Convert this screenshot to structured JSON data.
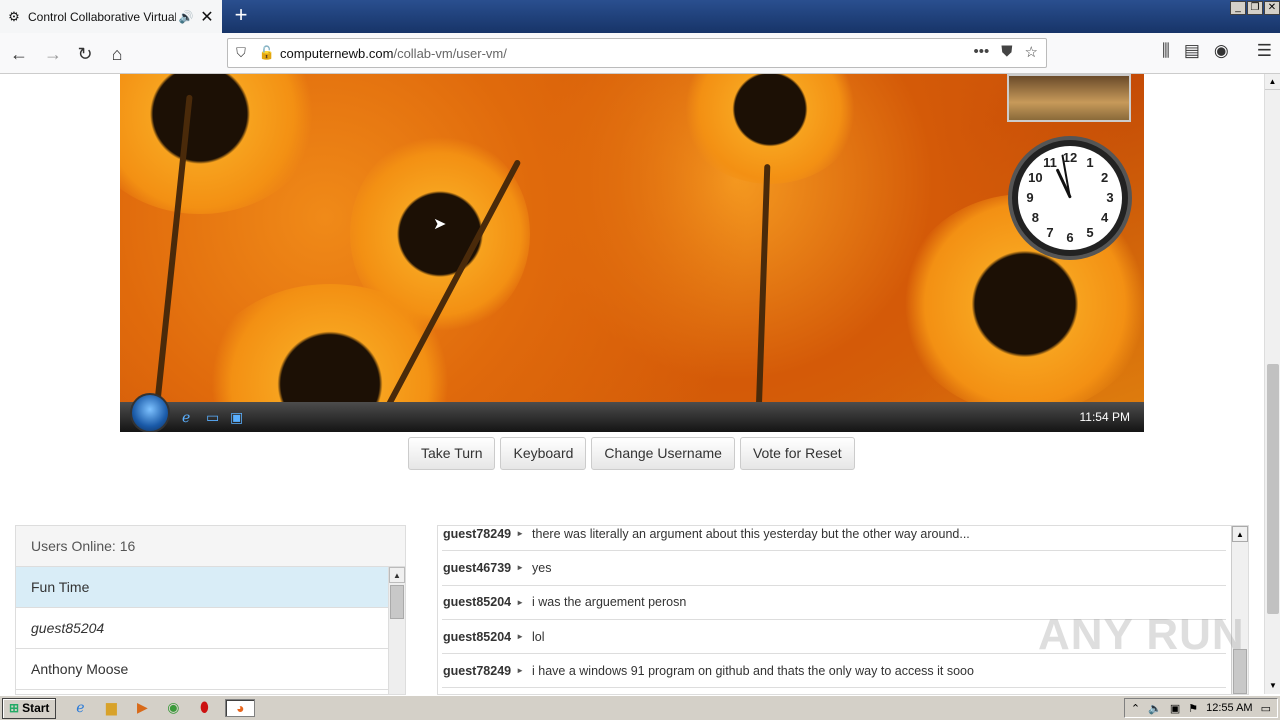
{
  "browser": {
    "tab_title": "Control Collaborative Virtual M",
    "url_host": "computernewb.com",
    "url_path": "/collab-vm/user-vm/"
  },
  "vm": {
    "clock_time": "11:54 PM",
    "clock_numbers": [
      "12",
      "1",
      "2",
      "3",
      "4",
      "5",
      "6",
      "7",
      "8",
      "9",
      "10",
      "11"
    ]
  },
  "controls": {
    "take_turn": "Take Turn",
    "keyboard": "Keyboard",
    "change_username": "Change Username",
    "vote_reset": "Vote for Reset"
  },
  "users": {
    "header": "Users Online: 16",
    "list": [
      "Fun Time",
      "guest85204",
      "Anthony Moose"
    ]
  },
  "chat": {
    "messages": [
      {
        "user": "guest78249",
        "text": "there was literally an argument about this yesterday but the other way around..."
      },
      {
        "user": "guest46739",
        "text": "yes"
      },
      {
        "user": "guest85204",
        "text": "i was the arguement perosn"
      },
      {
        "user": "guest85204",
        "text": "lol"
      },
      {
        "user": "guest78249",
        "text": "i have a windows 91 program on github and thats the only way to access it sooo"
      }
    ]
  },
  "watermark": "ANY RUN",
  "taskbar": {
    "start": "Start",
    "time": "12:55 AM"
  },
  "colors": {
    "selected_user_bg": "#d9edf7",
    "tab_bar": "#1e3d73"
  }
}
